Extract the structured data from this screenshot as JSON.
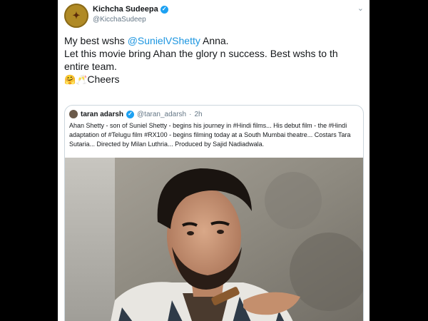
{
  "tweet": {
    "display_name": "Kichcha Sudeepa",
    "handle": "@KicchaSudeep",
    "text_lead": "My best wshs ",
    "mention": "@SunielVShetty",
    "text_after_mention": " Anna.",
    "line2": "Let this movie bring Ahan the glory n success. Best wshs to th",
    "line3": "entire team.",
    "emojis": "🤗🥂",
    "cheers": "Cheers"
  },
  "quoted_tweet": {
    "display_name": "taran adarsh",
    "handle": "@taran_adarsh",
    "separator": "·",
    "time": "2h",
    "text": "Ahan Shetty - son of Suniel Shetty - begins his journey in #Hindi films... His debut film - the #Hindi adaptation of #Telugu film #RX100 - begins filming today at a South Mumbai theatre... Costars Tara Sutaria... Directed by Milan Luthria... Produced by Sajid Nadiadwala."
  },
  "icons": {
    "verified": "verified-badge-icon",
    "menu": "chevron-down-icon"
  },
  "colors": {
    "link": "#1b95e0",
    "verified": "#1da1f2",
    "text": "#14171a",
    "secondary": "#657786"
  }
}
